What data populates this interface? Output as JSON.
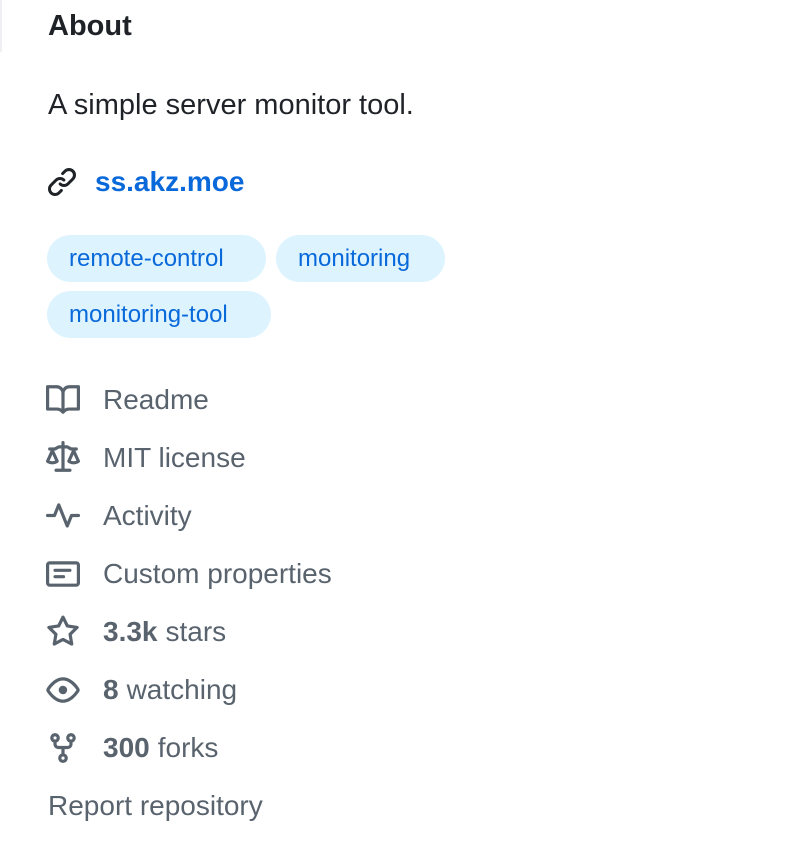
{
  "about": {
    "title": "About",
    "description": "A simple server monitor tool.",
    "homepage": "ss.akz.moe"
  },
  "topics": [
    "remote-control",
    "monitoring",
    "monitoring-tool"
  ],
  "meta": {
    "readme": "Readme",
    "license": "MIT license",
    "activity": "Activity",
    "custom_properties": "Custom properties",
    "stars_count": "3.3k",
    "stars_label": "stars",
    "watching_count": "8",
    "watching_label": "watching",
    "forks_count": "300",
    "forks_label": "forks"
  },
  "report": "Report repository",
  "icons": {
    "homepage": "link-icon",
    "readme": "book-icon",
    "license": "scale-icon",
    "activity": "pulse-icon",
    "custom_properties": "note-icon",
    "stars": "star-icon",
    "watching": "eye-icon",
    "forks": "fork-icon"
  },
  "colors": {
    "link": "#0969da",
    "topic_bg": "#ddf4ff",
    "muted": "#59636e",
    "text": "#1f2328"
  }
}
